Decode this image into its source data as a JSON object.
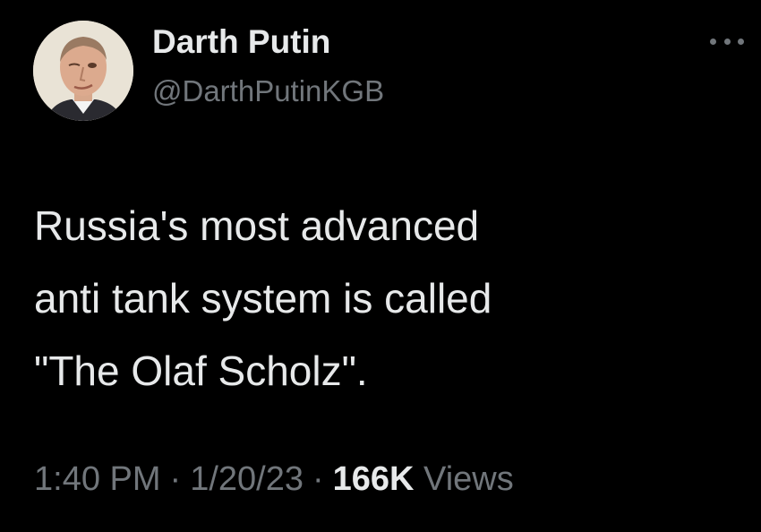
{
  "author": {
    "display_name": "Darth Putin",
    "handle": "@DarthPutinKGB",
    "avatar_icon": "profile-photo"
  },
  "more_icon": "more-horizontal-icon",
  "tweet": {
    "lines": [
      "Russia's most advanced",
      "anti tank system is called",
      "\"The Olaf Scholz\"."
    ]
  },
  "meta": {
    "time": "1:40 PM",
    "separator": "·",
    "date": "1/20/23",
    "views_count": "166K",
    "views_label": "Views"
  },
  "colors": {
    "background": "#000000",
    "primary_text": "#e7e9ea",
    "secondary_text": "#71767b"
  }
}
